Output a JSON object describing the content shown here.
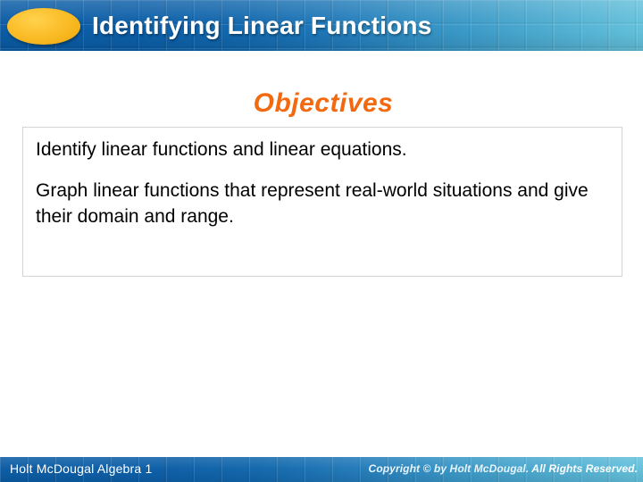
{
  "header": {
    "title": "Identifying Linear Functions",
    "logo_shape": "yellow-ellipse",
    "gradient_start": "#0a5ba4",
    "gradient_end": "#63c0da",
    "ellipse_color": "#f5b319",
    "title_color": "#ffffff"
  },
  "body": {
    "heading": "Objectives",
    "heading_color": "#F2690F",
    "objectives": [
      "Identify linear functions and linear equations.",
      "Graph linear functions that represent real-world situations and give their domain and range."
    ],
    "box_border_color": "#d4d4d4",
    "text_color": "#000000"
  },
  "footer": {
    "left_label": "Holt McDougal Algebra 1",
    "copyright_prefix": "Copyright © by Holt McDougal.",
    "copyright_suffix": "All Rights Reserved.",
    "gradient_start": "#0a5ba4",
    "gradient_end": "#64c1db",
    "text_color": "#ffffff"
  }
}
